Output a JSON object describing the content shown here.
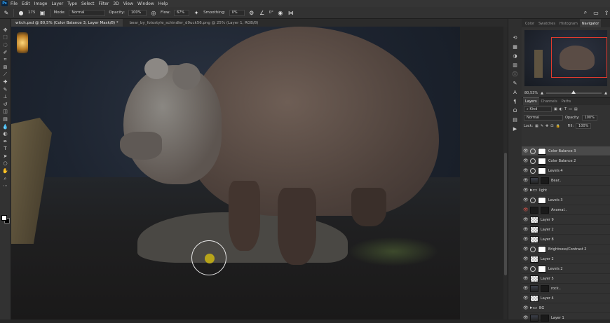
{
  "menu": [
    "File",
    "Edit",
    "Image",
    "Layer",
    "Type",
    "Select",
    "Filter",
    "3D",
    "View",
    "Window",
    "Help"
  ],
  "options": {
    "size": "175",
    "mode_label": "Mode:",
    "mode_value": "Normal",
    "opacity_label": "Opacity:",
    "opacity_value": "100%",
    "flow_label": "Flow:",
    "flow_value": "67%",
    "smoothing_label": "Smoothing:",
    "smoothing_value": "0%",
    "angle_value": "0°"
  },
  "tabs": [
    {
      "label": "witch.psd @ 80,5% (Color Balance 3, Layer Mask/8) *",
      "active": true
    },
    {
      "label": "bear_by_fotostyle_schindler_d9uck56.png @ 25% (Layer 1, RGB/8)",
      "active": false
    }
  ],
  "panels": {
    "top_tabs": [
      "Color",
      "Swatches",
      "Histogram",
      "Navigator"
    ],
    "zoom_value": "80,53%",
    "layer_tabs": [
      "Layers",
      "Channels",
      "Paths"
    ],
    "kind_label": "Kind",
    "blend_mode": "Normal",
    "opacity_label": "Opacity:",
    "opacity_value": "100%",
    "lock_label": "Lock:",
    "fill_label": "Fill:",
    "fill_value": "100%"
  },
  "layers": [
    {
      "name": "Color Balance 3",
      "thumb": "adj",
      "selected": true
    },
    {
      "name": "Color Balance 2",
      "thumb": "adj"
    },
    {
      "name": "Levels 4",
      "thumb": "adj"
    },
    {
      "name": "Bear..",
      "thumb": "img"
    },
    {
      "name": "light",
      "thumb": "folder"
    },
    {
      "name": "Levels 3",
      "thumb": "adj"
    },
    {
      "name": "Anomal..",
      "thumb": "dark",
      "eye_red": true
    },
    {
      "name": "Layer 9",
      "thumb": "check"
    },
    {
      "name": "Layer 2",
      "thumb": "check"
    },
    {
      "name": "Layer 8",
      "thumb": "check"
    },
    {
      "name": "Brightness/Contrast 2",
      "thumb": "adj"
    },
    {
      "name": "Layer 2",
      "thumb": "check"
    },
    {
      "name": "Levels 2",
      "thumb": "adj"
    },
    {
      "name": "Layer 5",
      "thumb": "check"
    },
    {
      "name": "rock..",
      "thumb": "img"
    },
    {
      "name": "Layer 4",
      "thumb": "check"
    },
    {
      "name": "BG",
      "thumb": "folder"
    },
    {
      "name": "Layer 1",
      "thumb": "img"
    }
  ],
  "colors": {
    "accent_red": "#e23b2e",
    "brush_yellow": "#b7a41a"
  }
}
